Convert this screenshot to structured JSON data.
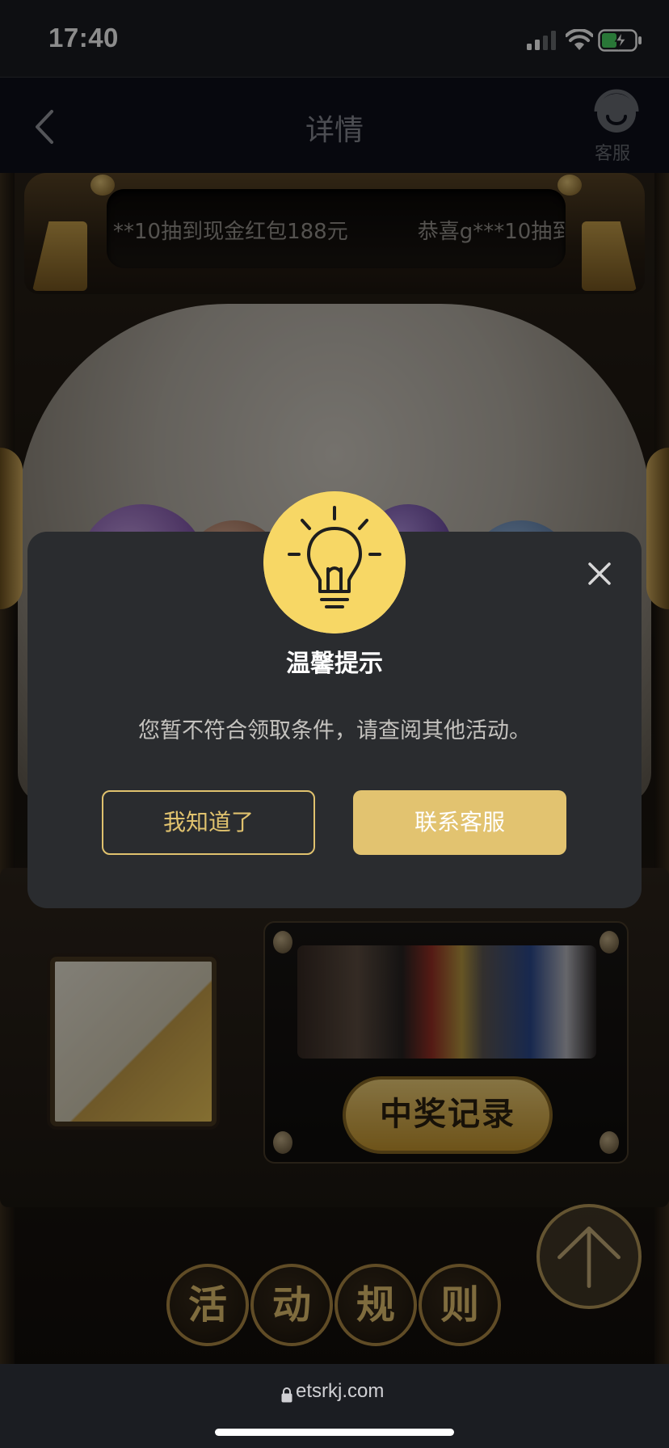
{
  "status_bar": {
    "time": "17:40"
  },
  "nav": {
    "title": "详情",
    "service_label": "客服"
  },
  "marquee": {
    "items": [
      "**10抽到现金红包188元",
      "恭喜g***10抽到"
    ]
  },
  "machine": {
    "records_label": "中奖记录",
    "rules_chars": [
      "活",
      "动",
      "规",
      "则"
    ]
  },
  "dialog": {
    "title": "温馨提示",
    "message": "您暂不符合领取条件，请查阅其他活动。",
    "dismiss_label": "我知道了",
    "contact_label": "联系客服"
  },
  "browser": {
    "url": "etsrkj.com"
  },
  "colors": {
    "accent_gold": "#e2c370",
    "modal_bg": "#2a2c2f",
    "bulb_yellow": "#f6d35a"
  }
}
